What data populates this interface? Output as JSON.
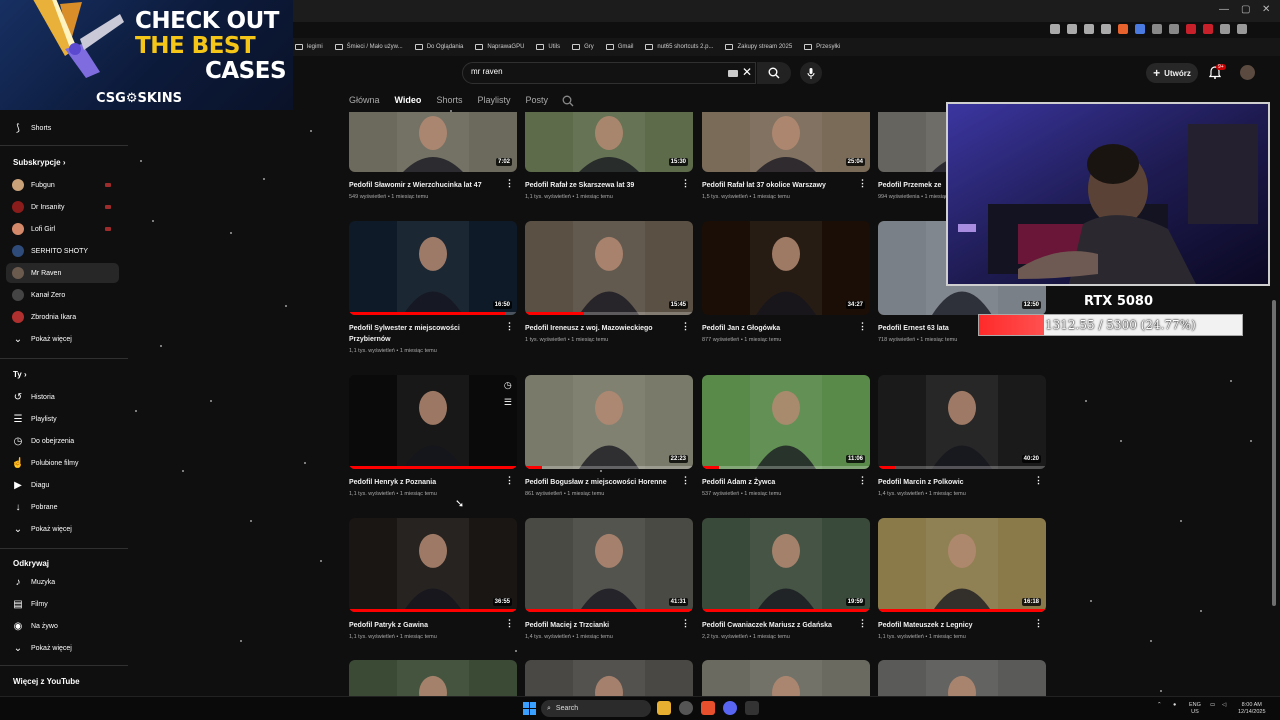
{
  "promo": {
    "line1": "CHECK OUT",
    "line2": "THE BEST",
    "line3": "CASES",
    "logo": "CSG⚙SKINS",
    "colors": {
      "white": "#ffffff",
      "gold": "#f5c518"
    }
  },
  "bookmarks": [
    {
      "label": "legimi",
      "icon": "folder-icon"
    },
    {
      "label": "Śmieci / Mało używ...",
      "icon": "folder-icon"
    },
    {
      "label": "Do Oglądania",
      "icon": "folder-icon"
    },
    {
      "label": "NaprawaGPU",
      "icon": "folder-icon"
    },
    {
      "label": "Utils",
      "icon": "folder-icon"
    },
    {
      "label": "Gry",
      "icon": "folder-icon"
    },
    {
      "label": "Gmail",
      "icon": "gmail-icon"
    },
    {
      "label": "nut65 shortcuts 2.p...",
      "icon": "link-icon"
    },
    {
      "label": "Zakupy stream 2025",
      "icon": "folder-icon"
    },
    {
      "label": "Przesyłki",
      "icon": "folder-icon"
    }
  ],
  "header": {
    "search_value": "mr raven",
    "create_label": "Utwórz",
    "notifications_badge": "9+"
  },
  "channel_tabs": [
    {
      "label": "Główna",
      "active": false
    },
    {
      "label": "Wideo",
      "active": true
    },
    {
      "label": "Shorts",
      "active": false
    },
    {
      "label": "Playlisty",
      "active": false
    },
    {
      "label": "Posty",
      "active": false
    }
  ],
  "sidebar": {
    "shorts_label": "Shorts",
    "subs_heading": "Subskrypcje",
    "subscriptions": [
      {
        "label": "Fubgun",
        "live": true,
        "color": "#c9a27a"
      },
      {
        "label": "Dr Insanity",
        "live": true,
        "color": "#8a1c1c"
      },
      {
        "label": "Lofi Girl",
        "live": true,
        "color": "#d48a6a"
      },
      {
        "label": "SERHITO SHOTY",
        "live": false,
        "color": "#2f4b7a"
      },
      {
        "label": "Mr Raven",
        "live": false,
        "color": "#6b5a4e"
      },
      {
        "label": "Kanał Zero",
        "live": false,
        "color": "#444444"
      },
      {
        "label": "Zbrodnia Ikara",
        "live": false,
        "color": "#b03030"
      }
    ],
    "show_more_1": "Pokaż więcej",
    "you_heading": "Ty",
    "you_items": [
      {
        "label": "Historia",
        "icon": "history-icon",
        "glyph": "↺"
      },
      {
        "label": "Playlisty",
        "icon": "playlist-icon",
        "glyph": "☰"
      },
      {
        "label": "Do obejrzenia",
        "icon": "clock-icon",
        "glyph": "◷"
      },
      {
        "label": "Polubione filmy",
        "icon": "thumbs-up-icon",
        "glyph": "☝"
      },
      {
        "label": "Diagu",
        "icon": "video-icon",
        "glyph": "▶"
      },
      {
        "label": "Pobrane",
        "icon": "download-icon",
        "glyph": "↓"
      }
    ],
    "show_more_2": "Pokaż więcej",
    "explore_heading": "Odkrywaj",
    "explore_items": [
      {
        "label": "Muzyka",
        "icon": "music-icon",
        "glyph": "♪"
      },
      {
        "label": "Filmy",
        "icon": "film-icon",
        "glyph": "▤"
      },
      {
        "label": "Na żywo",
        "icon": "live-icon",
        "glyph": "◉"
      }
    ],
    "show_more_3": "Pokaż więcej",
    "more_heading": "Więcej z YouTube"
  },
  "videos": [
    {
      "title": "Pedofil Sławomir z Wierzchucinka lat 47",
      "meta": "549 wyświetleń • 1 miesiąc temu",
      "duration": "7:02",
      "progress": 0,
      "bg": "#6c6a5c"
    },
    {
      "title": "Pedofil Rafał ze Skarszewa lat 39",
      "meta": "1,1 tys. wyświetleń • 1 miesiąc temu",
      "duration": "15:30",
      "progress": 0,
      "bg": "#5d6b4a"
    },
    {
      "title": "Pedofil Rafał lat 37 okolice Warszawy",
      "meta": "1,5 tys. wyświetleń • 1 miesiąc temu",
      "duration": "25:04",
      "progress": 0,
      "bg": "#7a6a58"
    },
    {
      "title": "Pedofil Przemek ze",
      "meta": "994 wyświetlenia • 1 miesiąc temu",
      "duration": "",
      "progress": 0,
      "bg": "#66645e"
    },
    {
      "title": "Pedofil Sylwester z miejscowości Przybiernów",
      "meta": "1,1 tys. wyświetleń • 1 miesiąc temu",
      "duration": "16:50",
      "progress": 0.93,
      "bg": "#0e1a28"
    },
    {
      "title": "Pedofil Ireneusz z woj. Mazowieckiego",
      "meta": "1 tys. wyświetleń • 1 miesiąc temu",
      "duration": "15:45",
      "progress": 0.35,
      "bg": "#5a5044"
    },
    {
      "title": "Pedofil Jan z Głogówka",
      "meta": "877 wyświetleń • 1 miesiąc temu",
      "duration": "34:27",
      "progress": 0,
      "bg": "#1a0e06"
    },
    {
      "title": "Pedofil Ernest 63 lata",
      "meta": "718 wyświetleń • 1 miesiąc temu",
      "duration": "12:50",
      "progress": 0,
      "bg": "#7a8088"
    },
    {
      "title": "Pedofil Henryk z Poznania",
      "meta": "1,1 tys. wyświetleń • 1 miesiąc temu",
      "duration": "",
      "progress": 1,
      "bg": "#0a0a0a",
      "hover": true
    },
    {
      "title": "Pedofil Bogusław z miejscowości Horenne",
      "meta": "861 wyświetleń • 1 miesiąc temu",
      "duration": "22:23",
      "progress": 0.1,
      "bg": "#7a7a6a"
    },
    {
      "title": "Pedofil Adam z Żywca",
      "meta": "537 wyświetleń • 1 miesiąc temu",
      "duration": "11:06",
      "progress": 0.1,
      "bg": "#5a8a4a"
    },
    {
      "title": "Pedofil Marcin z Polkowic",
      "meta": "1,4 tys. wyświetleń • 1 miesiąc temu",
      "duration": "40:20",
      "progress": 0.1,
      "bg": "#1a1a1a"
    },
    {
      "title": "Pedofil Patryk z Gawina",
      "meta": "1,1 tys. wyświetleń • 1 miesiąc temu",
      "duration": "36:55",
      "progress": 1,
      "bg": "#1a1614"
    },
    {
      "title": "Pedofil Maciej z Trzcianki",
      "meta": "1,4 tys. wyświetleń • 1 miesiąc temu",
      "duration": "41:31",
      "progress": 1,
      "bg": "#4a4a44"
    },
    {
      "title": "Pedofil Cwaniaczek Mariusz z Gdańska",
      "meta": "2,2 tys. wyświetleń • 1 miesiąc temu",
      "duration": "19:59",
      "progress": 1,
      "bg": "#3a4a3a"
    },
    {
      "title": "Pedofil Mateuszek z Legnicy",
      "meta": "1,1 tys. wyświetleń • 1 miesiąc temu",
      "duration": "16:18",
      "progress": 1,
      "bg": "#8a7a4a"
    },
    {
      "title": "",
      "meta": "",
      "duration": "",
      "progress": 0,
      "bg": "#3a4a34"
    },
    {
      "title": "",
      "meta": "",
      "duration": "",
      "progress": 0,
      "bg": "#4a4844"
    },
    {
      "title": "",
      "meta": "",
      "duration": "",
      "progress": 0,
      "bg": "#6a6a60"
    },
    {
      "title": "",
      "meta": "",
      "duration": "",
      "progress": 0,
      "bg": "#5a5a58"
    }
  ],
  "overlay": {
    "gpu_label": "RTX 5080",
    "gpu_text": "1312.55 / 5300 (24.77%)",
    "gpu_fraction": 0.2477,
    "colors": {
      "fill": "#ff2a2a",
      "track": "#f2f2f2"
    }
  },
  "taskbar": {
    "search_label": "Search",
    "lang_1": "ENG",
    "lang_2": "US",
    "time": "8:00 AM",
    "date": "12/14/2025"
  }
}
